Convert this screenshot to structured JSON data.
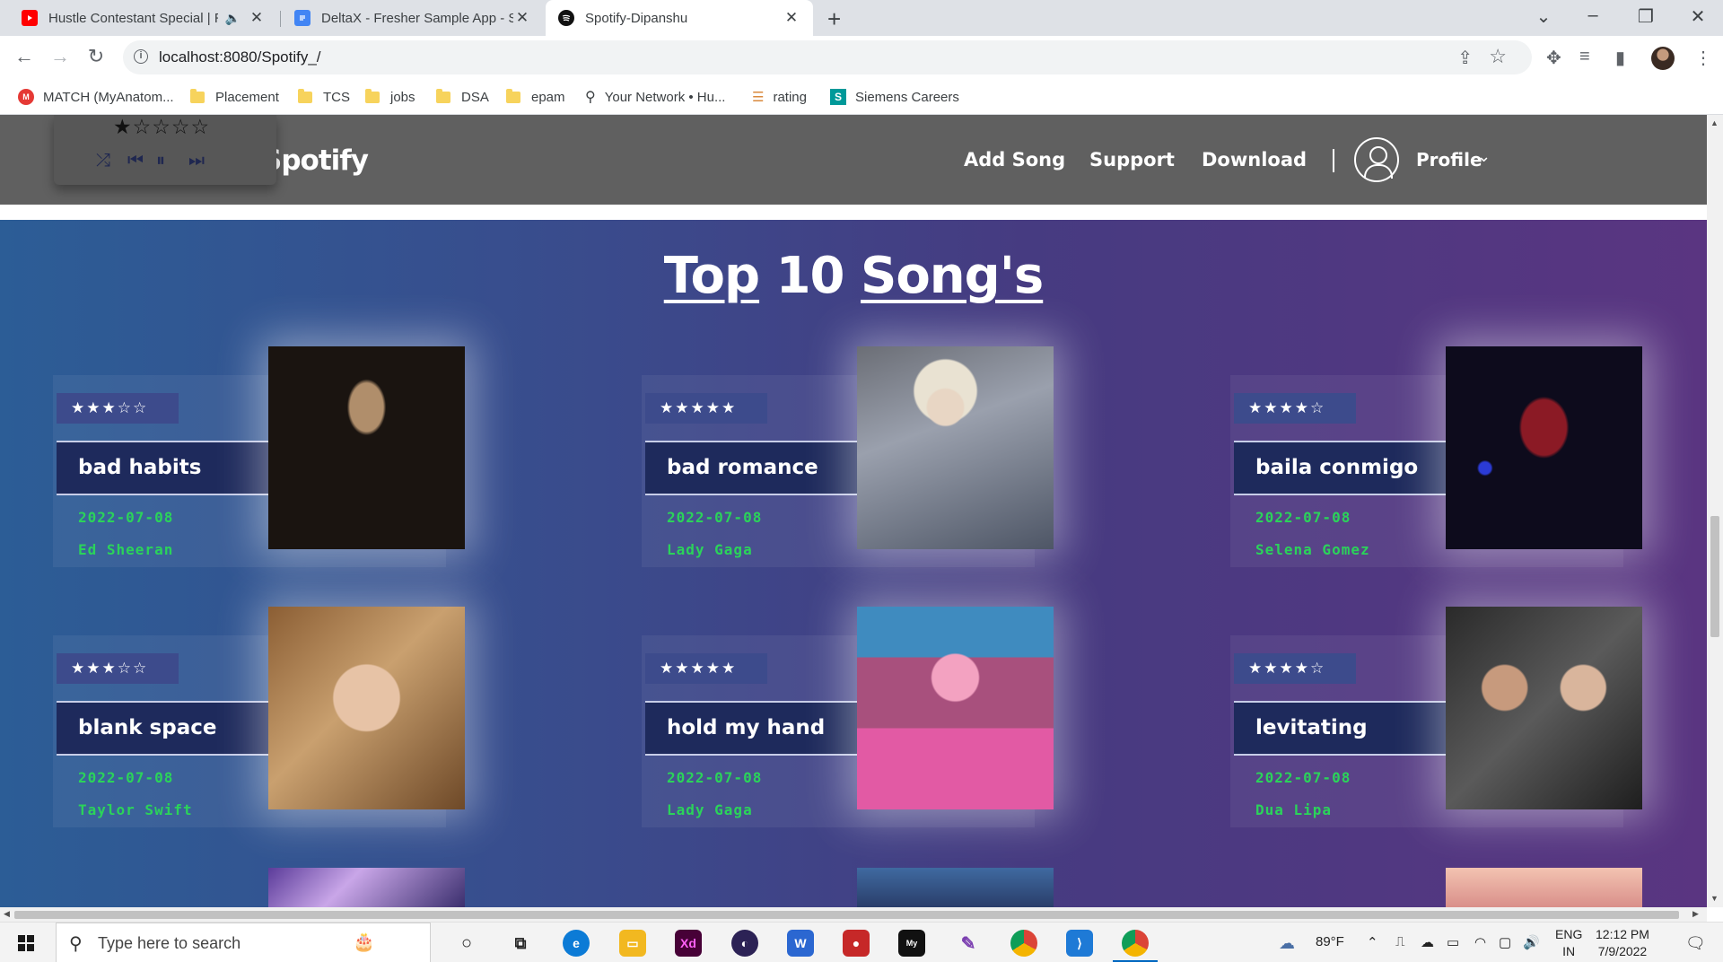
{
  "browser": {
    "tabs": [
      {
        "title": "Hustle Contestant Special | R",
        "muted_icon": "speaker-muted-icon"
      },
      {
        "title": "DeltaX - Fresher Sample App - Sp"
      },
      {
        "title": "Spotify-Dipanshu"
      }
    ],
    "url": "localhost:8080/Spotify_/",
    "bookmarks": [
      "MATCH (MyAnatom...",
      "Placement",
      "TCS",
      "jobs",
      "DSA",
      "epam",
      "Your Network • Hu...",
      "rating",
      "Siemens Careers"
    ]
  },
  "player": {
    "rating": "★☆☆☆☆"
  },
  "site": {
    "brand": "Spotify",
    "nav": {
      "add_song": "Add Song",
      "support": "Support",
      "download": "Download",
      "profile": "Profile"
    }
  },
  "hero": {
    "title_part1": "Top",
    "title_part2": " 10 ",
    "title_part3": "Song's"
  },
  "songs": [
    {
      "title": "bad habits",
      "date": "2022-07-08",
      "artist": "Ed Sheeran",
      "stars": "★★★☆☆"
    },
    {
      "title": "bad romance",
      "date": "2022-07-08",
      "artist": "Lady Gaga",
      "stars": "★★★★★"
    },
    {
      "title": "baila conmigo",
      "date": "2022-07-08",
      "artist": "Selena Gomez",
      "stars": "★★★★☆"
    },
    {
      "title": "blank space",
      "date": "2022-07-08",
      "artist": "Taylor Swift",
      "stars": "★★★☆☆"
    },
    {
      "title": "hold my hand",
      "date": "2022-07-08",
      "artist": "Lady Gaga",
      "stars": "★★★★★"
    },
    {
      "title": "levitating",
      "date": "2022-07-08",
      "artist": "Dua Lipa",
      "stars": "★★★★☆"
    }
  ],
  "taskbar": {
    "search_placeholder": "Type here to search",
    "weather": "89°F",
    "lang_top": "ENG",
    "lang_bottom": "IN",
    "time": "12:12 PM",
    "date": "7/9/2022"
  },
  "colors": {
    "accent_green": "#2bd35a",
    "header_gray": "#606060",
    "title_box": "#1e2a5c"
  }
}
